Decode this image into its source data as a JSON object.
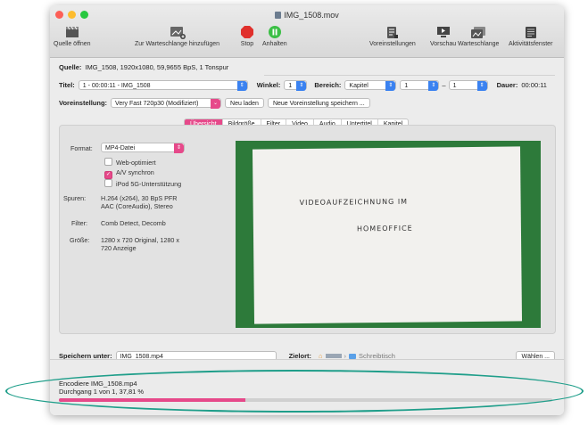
{
  "window": {
    "title": "IMG_1508.mov"
  },
  "toolbar": {
    "open": "Quelle öffnen",
    "add_queue": "Zur Warteschlange hinzufügen",
    "stop": "Stop",
    "pause": "Anhalten",
    "presets": "Voreinstellungen",
    "preview": "Vorschau",
    "queue": "Warteschlange",
    "activity": "Aktivitätsfenster"
  },
  "source": {
    "label": "Quelle:",
    "value": "IMG_1508, 1920x1080, 59,9655 BpS, 1 Tonspur"
  },
  "title_row": {
    "title_label": "Titel:",
    "title_value": "1 - 00:00:11 - IMG_1508",
    "angle_label": "Winkel:",
    "angle_value": "1",
    "range_label": "Bereich:",
    "range_type": "Kapitel",
    "range_from": "1",
    "range_dash": "–",
    "range_to": "1",
    "duration_label": "Dauer:",
    "duration_value": "00:00:11"
  },
  "preset": {
    "label": "Voreinstellung:",
    "value": "Very Fast 720p30 (Modifiziert)",
    "reload": "Neu laden",
    "save_new": "Neue Voreinstellung speichern ..."
  },
  "tabs": [
    "Übersicht",
    "Bildgröße",
    "Filter",
    "Video",
    "Audio",
    "Untertitel",
    "Kapitel"
  ],
  "summary": {
    "format_label": "Format:",
    "format_value": "MP4-Datei",
    "web_optimized": "Web-optimiert",
    "av_sync": "A/V synchron",
    "ipod": "iPod 5G-Unterstützung",
    "tracks_label": "Spuren:",
    "tracks_1": "H.264 (x264), 30 BpS PFR",
    "tracks_2": "AAC (CoreAudio), Stereo",
    "filter_label": "Filter:",
    "filter_value": "Comb Detect, Decomb",
    "size_label": "Größe:",
    "size_1": "1280 x 720 Original, 1280 x",
    "size_2": "720 Anzeige"
  },
  "preview_text": {
    "line1": "VIDEOAUFZEICHNUNG IM",
    "line2": "HOMEOFFICE"
  },
  "save": {
    "label": "Speichern unter:",
    "filename": "IMG_1508.mp4",
    "dest_label": "Zielort:",
    "dest_folder": "Schreibtisch",
    "choose": "Wählen ..."
  },
  "status": {
    "line1": "Encodiere IMG_1508.mp4",
    "line2": "Durchgang 1 von 1, 37,81 %",
    "progress": 0.3781
  },
  "colors": {
    "accent": "#e6498a",
    "annotation": "#1f9e8a"
  }
}
